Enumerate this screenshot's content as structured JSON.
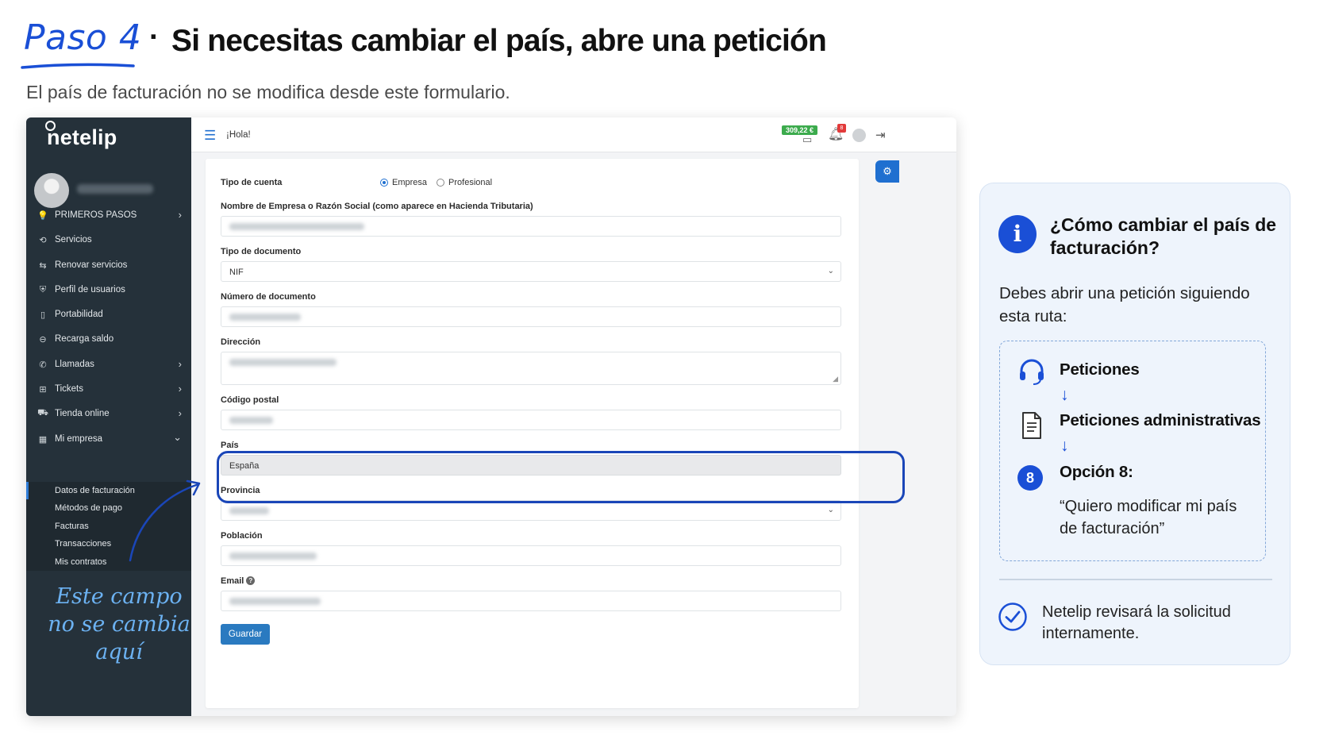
{
  "slide": {
    "step_label": "Paso 4",
    "separator": "·",
    "headline": "Si necesitas cambiar el país, abre una petición",
    "subheadline": "El país de facturación no se modifica desde este formulario."
  },
  "app": {
    "brand": "netelip",
    "greeting": "¡Hola!",
    "balance": "309,22 €",
    "notification_count": "8",
    "menu": [
      {
        "label": "PRIMEROS PASOS",
        "icon": "💡",
        "chevron": "›"
      },
      {
        "label": "Servicios",
        "icon": "⟲",
        "chevron": ""
      },
      {
        "label": "Renovar servicios",
        "icon": "⇆",
        "chevron": ""
      },
      {
        "label": "Perfil de usuarios",
        "icon": "⛨",
        "chevron": ""
      },
      {
        "label": "Portabilidad",
        "icon": "▯",
        "chevron": ""
      },
      {
        "label": "Recarga saldo",
        "icon": "⊖",
        "chevron": ""
      },
      {
        "label": "Llamadas",
        "icon": "✆",
        "chevron": "›"
      },
      {
        "label": "Tickets",
        "icon": "⊞",
        "chevron": "›"
      },
      {
        "label": "Tienda online",
        "icon": "⛟",
        "chevron": "›"
      },
      {
        "label": "Mi empresa",
        "icon": "▦",
        "chevron": "⌄"
      }
    ],
    "submenu": [
      "Datos de facturación",
      "Métodos de pago",
      "Facturas",
      "Transacciones",
      "Mis contratos"
    ],
    "form": {
      "account_type_label": "Tipo de cuenta",
      "account_type_options": [
        "Empresa",
        "Profesional"
      ],
      "company_name_label": "Nombre de Empresa o Razón Social (como aparece en Hacienda Tributaria)",
      "document_type_label": "Tipo de documento",
      "document_type_value": "NIF",
      "document_number_label": "Número de documento",
      "address_label": "Dirección",
      "postal_code_label": "Código postal",
      "country_label": "País",
      "country_value": "España",
      "province_label": "Provincia",
      "city_label": "Población",
      "email_label": "Email",
      "save_label": "Guardar"
    }
  },
  "annotation": {
    "line1": "Este campo",
    "line2": "no se cambia",
    "line3": "aquí"
  },
  "info": {
    "title": "¿Cómo cambiar el país de facturación?",
    "intro": "Debes abrir una petición siguiendo esta ruta:",
    "steps": {
      "step1": "Peticiones",
      "step2": "Peticiones administrativas",
      "step3_number": "8",
      "step3_title": "Opción 8:",
      "step3_desc": "“Quiero modificar mi país de facturación”"
    },
    "arrow": "↓",
    "footer": "Netelip revisará la solicitud internamente."
  },
  "colors": {
    "accent": "#1a4fd6",
    "sidebar": "#25313a",
    "button": "#2a7ac0",
    "balance": "#3cab4d",
    "annotation": "#6cb2f2"
  }
}
